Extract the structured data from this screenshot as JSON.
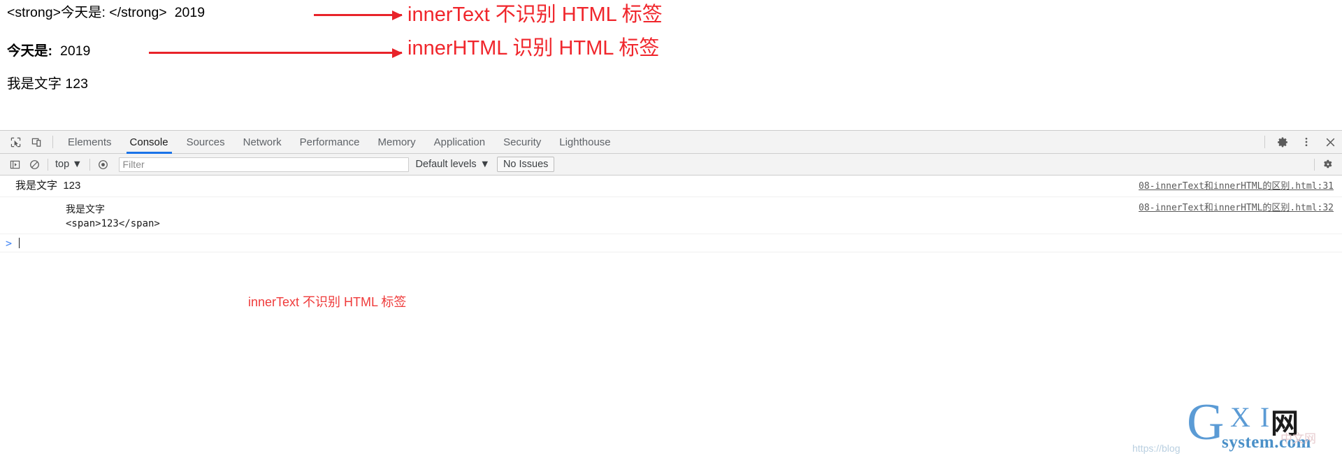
{
  "page": {
    "line1": {
      "raw_markup_text": "<strong>今天是: </strong>",
      "value": "2019"
    },
    "line2": {
      "label": "今天是:",
      "value": "2019"
    },
    "line3": {
      "text": "我是文字 123"
    },
    "annotations": [
      {
        "text": "innerText 不识别 HTML 标签",
        "color": "#f0262c"
      },
      {
        "text": "innerHTML 识别 HTML 标签",
        "color": "#f0262c"
      }
    ]
  },
  "devtools": {
    "left_icons": [
      {
        "name": "inspect-element-icon"
      },
      {
        "name": "device-toolbar-icon"
      }
    ],
    "tabs": [
      {
        "label": "Elements",
        "active": false
      },
      {
        "label": "Console",
        "active": true
      },
      {
        "label": "Sources",
        "active": false
      },
      {
        "label": "Network",
        "active": false
      },
      {
        "label": "Performance",
        "active": false
      },
      {
        "label": "Memory",
        "active": false
      },
      {
        "label": "Application",
        "active": false
      },
      {
        "label": "Security",
        "active": false
      },
      {
        "label": "Lighthouse",
        "active": false
      }
    ],
    "active_tab_accent": "#1a73e8",
    "right_icons": [
      {
        "name": "settings-gear-icon"
      },
      {
        "name": "more-options-icon"
      },
      {
        "name": "close-devtools-icon"
      }
    ],
    "console_toolbar": {
      "sidebar_toggle": "console-sidebar-icon",
      "clear_console": "clear-console-icon",
      "context": "top",
      "live_expression": "eye-icon",
      "filter_placeholder": "Filter",
      "filter_value": "",
      "levels": "Default levels",
      "issues_label": "No Issues",
      "settings": "console-settings-gear-icon"
    },
    "console_messages": [
      {
        "text": "我是文字  123",
        "source": "08-innerText和innerHTML的区别.html:31",
        "mono": false
      },
      {
        "text": "我是文字\n<span>123</span>",
        "source": "08-innerText和innerHTML的区别.html:32",
        "mono": true
      }
    ],
    "prompt": {
      "symbol": ">",
      "value": ""
    },
    "console_annotation": "innerText 不识别 HTML 标签"
  },
  "watermark": {
    "url": "https://blog",
    "g": "G",
    "xi": "X I",
    "wang": "网",
    "system": "system.com",
    "ghost": "中文网"
  }
}
